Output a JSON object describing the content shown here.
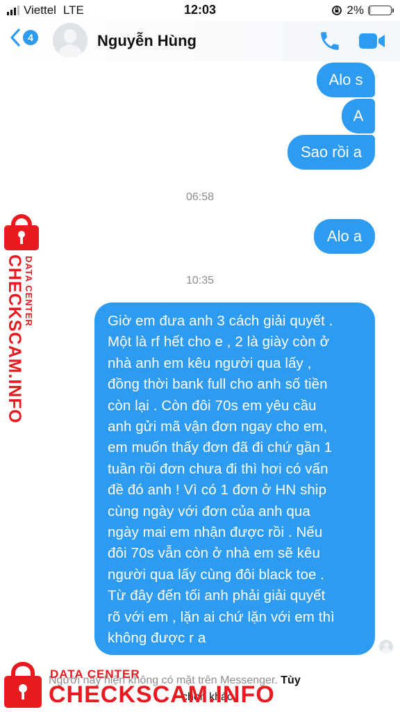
{
  "status_bar": {
    "carrier": "Viettel",
    "network": "LTE",
    "time": "12:03",
    "battery_percent": "2%",
    "battery_level": 0.02,
    "icons": [
      "signal-icon",
      "rotation-lock-icon",
      "battery-icon"
    ]
  },
  "header": {
    "back_badge": "4",
    "contact_name": "Nguyễn Hùng",
    "icons": [
      "back-chevron-icon",
      "avatar",
      "phone-icon",
      "video-camera-icon"
    ]
  },
  "messages": {
    "m1": "Alo s",
    "m2": "A",
    "m3": "Sao rồi a",
    "ts1": "06:58",
    "m4": "Alo a",
    "ts2": "10:35",
    "m5_lines": [
      "Giờ em đưa anh 3 cách giải quyết .",
      "Một là rf hết cho e , 2 là giày còn ở",
      "nhà anh em kêu người qua lấy ,",
      "đồng thời bank full cho anh số tiền",
      "còn lại . Còn đôi 70s em yêu cầu",
      "anh gửi mã vận đơn ngay cho em,",
      "em muốn thấy đơn đã đi chứ gần 1",
      "tuần rồi đơn chưa đi thì hơi có vấn",
      "đề đó anh ! Vì có 1 đơn ở HN ship",
      "cùng ngày với đơn của anh qua",
      "ngày mai em nhận được rồi . Nếu",
      "đôi 70s vẫn còn ở nhà em sẽ kêu",
      "người qua lấy cùng đôi black toe .",
      "Từ đây đến tối anh phải giải quyết",
      "rõ với em , lặn ai chứ lặn với em thì",
      "không được r a"
    ]
  },
  "footer": {
    "notice": "Người này hiện không có mặt trên Messenger.",
    "more_link": "Tùy",
    "notice_line2": "chọn khác"
  },
  "watermark": {
    "small": "DATA CENTER",
    "large": "CHECKSCAM.INFO",
    "color": "#e8191f"
  },
  "colors": {
    "bubble": "#2d9bf0",
    "timestamp": "#8a8d92",
    "accent": "#2d9bf0"
  }
}
